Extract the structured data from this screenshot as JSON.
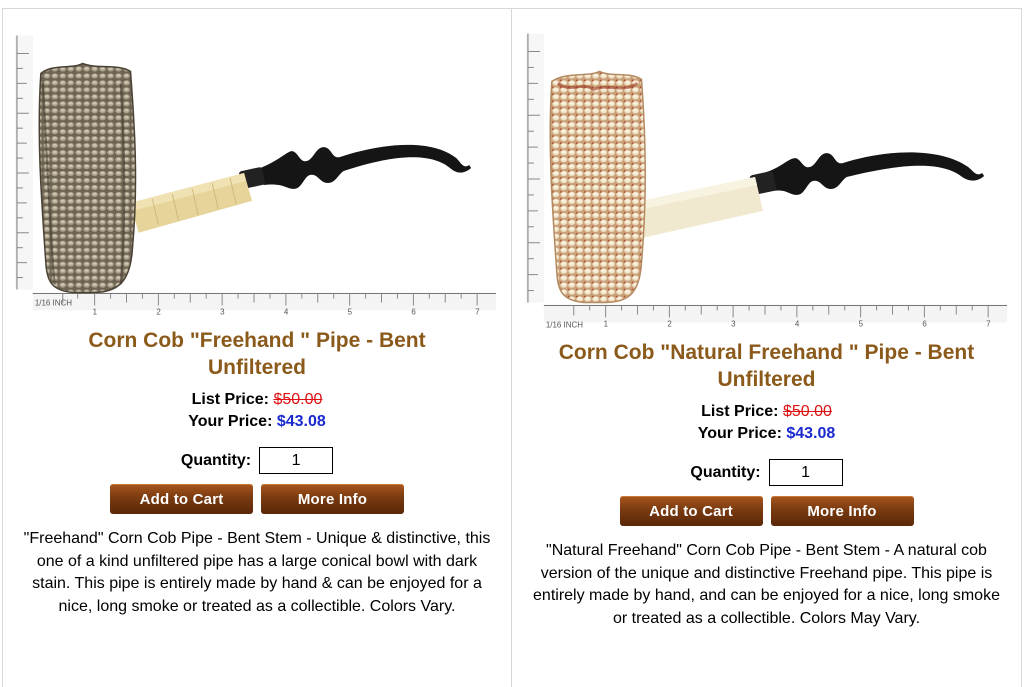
{
  "products": [
    {
      "title": "Corn Cob \"Freehand \" Pipe - Bent Unfiltered",
      "list_price_label": "List Price:",
      "list_price": "$50.00",
      "your_price_label": "Your Price:",
      "your_price": "$43.08",
      "quantity_label": "Quantity:",
      "quantity_value": "1",
      "add_to_cart_label": "Add to Cart",
      "more_info_label": "More Info",
      "description": "\"Freehand\" Corn Cob Pipe - Bent Stem - Unique & distinctive, this one of a kind unfiltered pipe has a large conical bowl with dark stain. This pipe is entirely made by hand & can be enjoyed for a nice, long smoke or treated as a collectible. Colors Vary.",
      "ruler_unit": "1/16 INCH",
      "ruler_numbers": [
        "1",
        "2",
        "3",
        "4",
        "5",
        "6",
        "7"
      ]
    },
    {
      "title": "Corn Cob \"Natural Freehand \" Pipe - Bent Unfiltered",
      "list_price_label": "List Price:",
      "list_price": "$50.00",
      "your_price_label": "Your Price:",
      "your_price": "$43.08",
      "quantity_label": "Quantity:",
      "quantity_value": "1",
      "add_to_cart_label": "Add to Cart",
      "more_info_label": "More Info",
      "description": "\"Natural Freehand\" Corn Cob Pipe - Bent Stem - A natural cob version of the unique and distinctive Freehand pipe. This pipe is entirely made by hand, and can be enjoyed for a nice, long smoke or treated as a collectible. Colors May Vary.",
      "ruler_unit": "1/16 INCH",
      "ruler_numbers": [
        "1",
        "2",
        "3",
        "4",
        "5",
        "6",
        "7"
      ]
    }
  ],
  "colors": {
    "title": "#8b5a1b",
    "list_price": "#dd1111",
    "your_price": "#1a2ad0",
    "button": "#7a3b10"
  }
}
